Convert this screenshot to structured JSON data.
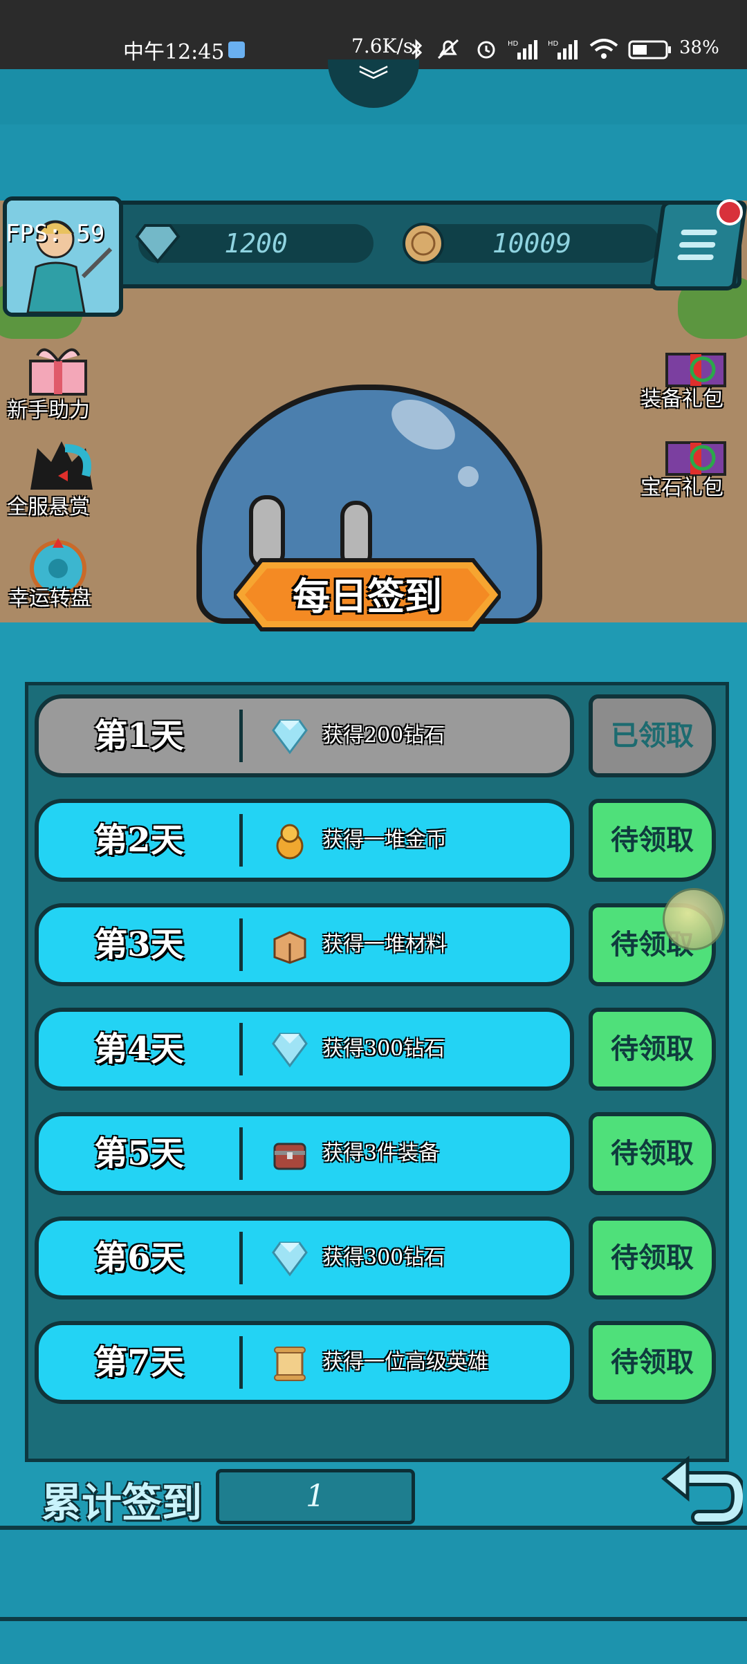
{
  "status_bar": {
    "time": "中午12:45",
    "network_speed": "7.6K/s",
    "battery": "38%",
    "icons": [
      "notification-icon",
      "bluetooth-icon",
      "mute-icon",
      "alarm-icon",
      "signal-hd-icon",
      "signal-hd-icon",
      "wifi-icon",
      "battery-icon"
    ]
  },
  "hud": {
    "fps": "FPS: 59",
    "diamonds": "1200",
    "gold": "10009"
  },
  "side_left": [
    {
      "label": "新手助力",
      "icon": "gift-icon"
    },
    {
      "label": "全服悬赏",
      "icon": "bounty-icon"
    },
    {
      "label": "幸运转盘",
      "icon": "wheel-icon"
    }
  ],
  "side_right": [
    {
      "label": "装备礼包",
      "icon": "equipment-gift-icon"
    },
    {
      "label": "宝石礼包",
      "icon": "gem-gift-icon"
    }
  ],
  "banner": {
    "title": "每日签到"
  },
  "checkin": [
    {
      "day": "第1天",
      "reward": "获得200钻石",
      "icon": "diamond-icon",
      "status": "已领取",
      "claimed": true
    },
    {
      "day": "第2天",
      "reward": "获得一堆金币",
      "icon": "coins-icon",
      "status": "待领取",
      "claimed": false
    },
    {
      "day": "第3天",
      "reward": "获得一堆材料",
      "icon": "box-icon",
      "status": "待领取",
      "claimed": false
    },
    {
      "day": "第4天",
      "reward": "获得300钻石",
      "icon": "diamond-icon",
      "status": "待领取",
      "claimed": false
    },
    {
      "day": "第5天",
      "reward": "获得3件装备",
      "icon": "chest-icon",
      "status": "待领取",
      "claimed": false
    },
    {
      "day": "第6天",
      "reward": "获得300钻石",
      "icon": "diamond-icon",
      "status": "待领取",
      "claimed": false
    },
    {
      "day": "第7天",
      "reward": "获得一位高级英雄",
      "icon": "scroll-icon",
      "status": "待领取",
      "claimed": false
    }
  ],
  "footer": {
    "cumulative_label": "累计签到",
    "cumulative_value": "1"
  },
  "colors": {
    "row_active": "#23d3f4",
    "row_done": "#9a9a9a",
    "claim_active": "#4fe07a",
    "frame": "#1d93ad"
  }
}
